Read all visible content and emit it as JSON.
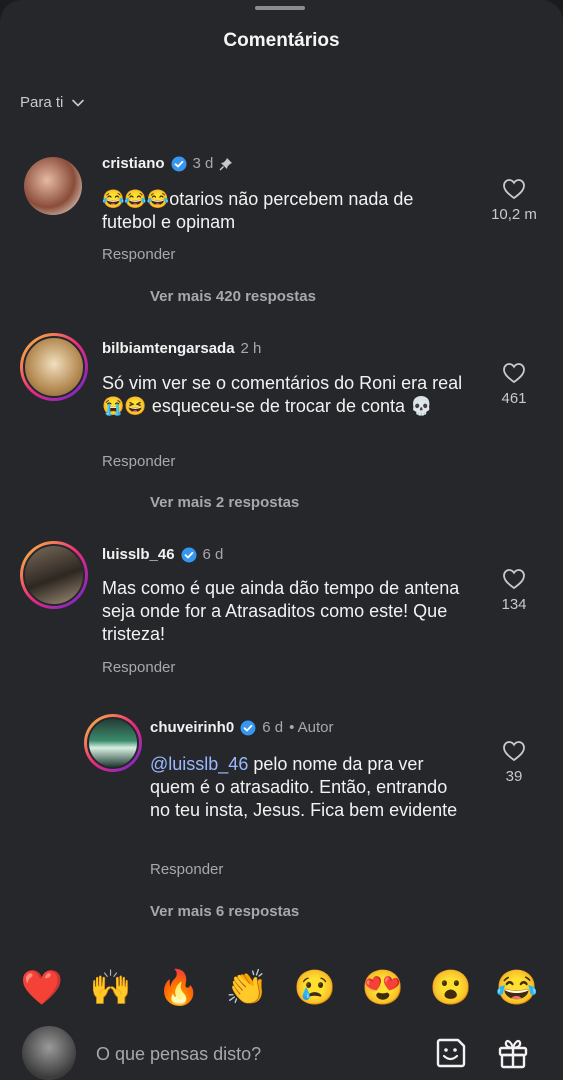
{
  "header": {
    "title": "Comentários"
  },
  "filter": {
    "label": "Para ti"
  },
  "comments": [
    {
      "username": "cristiano",
      "time": "3 d",
      "text_emoji": "😂😂😂",
      "text": "otarios não percebem nada de futebol e opinam",
      "reply_label": "Responder",
      "likes": "10,2 m",
      "more_replies": "Ver mais 420 respostas"
    },
    {
      "username": "bilbiamtengarsada",
      "time": "2 h",
      "text": "Só vim ver se o comentários do Roni era real 😭😆 esqueceu-se de trocar de conta 💀",
      "reply_label": "Responder",
      "likes": "461",
      "more_replies": "Ver mais 2 respostas"
    },
    {
      "username": "luisslb_46",
      "time": "6 d",
      "text": "Mas como é que ainda dão tempo de antena seja onde for a Atrasaditos como este! Que tristeza!",
      "reply_label": "Responder",
      "likes": "134"
    },
    {
      "username": "chuveirinh0",
      "time": "6 d",
      "author_badge": "• Autor",
      "mention": "@luisslb_46",
      "text": " pelo nome da pra ver quem é o atrasadito. Então, entrando no teu insta, Jesus. Fica bem evidente",
      "reply_label": "Responder",
      "likes": "39",
      "more_replies": "Ver mais 6 respostas"
    }
  ],
  "emoji_bar": [
    "❤️",
    "🙌",
    "🔥",
    "👏",
    "😢",
    "😍",
    "😮",
    "😂"
  ],
  "composer": {
    "placeholder": "O que pensas disto?"
  },
  "colors": {
    "background": "#26272b",
    "verified": "#3797f0",
    "like_outline": "#c9c9cc"
  }
}
